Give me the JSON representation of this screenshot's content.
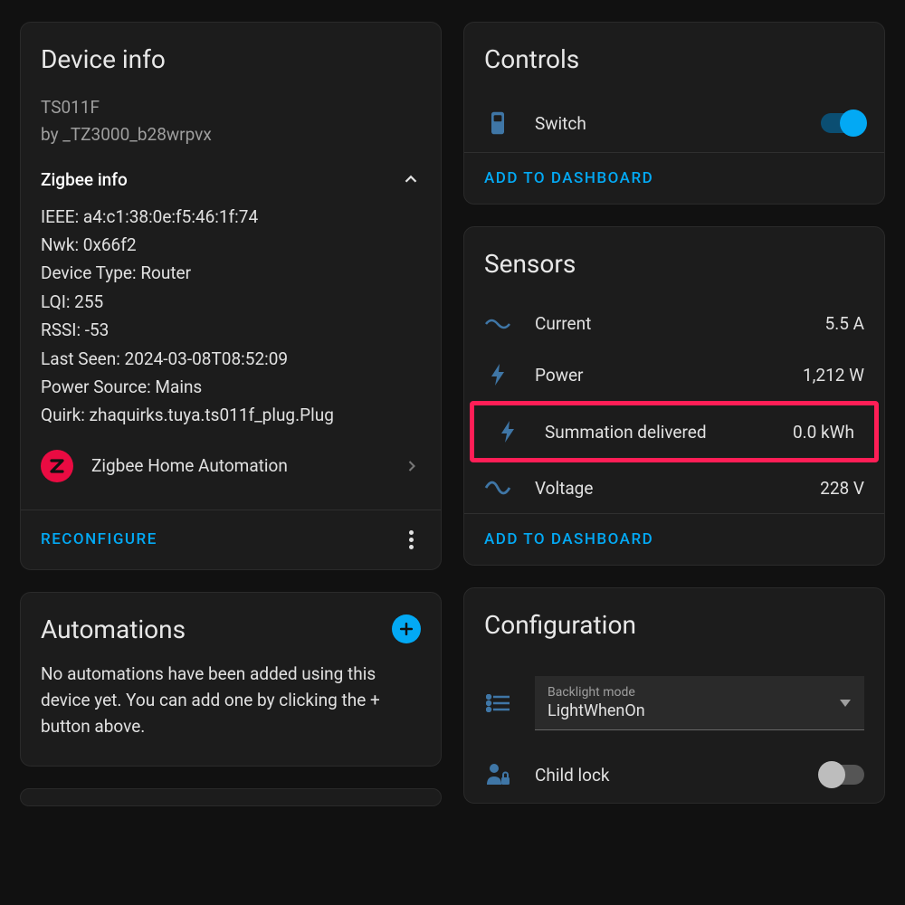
{
  "deviceInfo": {
    "title": "Device info",
    "model": "TS011F",
    "byline": "by _TZ3000_b28wrpvx",
    "zigbeeInfoLabel": "Zigbee info",
    "ieee": "IEEE: a4:c1:38:0e:f5:46:1f:74",
    "nwk": "Nwk: 0x66f2",
    "deviceType": "Device Type: Router",
    "lqi": "LQI: 255",
    "rssi": "RSSI: -53",
    "lastSeen": "Last Seen: 2024-03-08T08:52:09",
    "powerSource": "Power Source: Mains",
    "quirk": "Quirk: zhaquirks.tuya.ts011f_plug.Plug",
    "integration": "Zigbee Home Automation",
    "reconfigure": "RECONFIGURE"
  },
  "automations": {
    "title": "Automations",
    "body": "No automations have been added using this device yet. You can add one by clicking the + button above."
  },
  "controls": {
    "title": "Controls",
    "switchLabel": "Switch",
    "addToDashboard": "ADD TO DASHBOARD"
  },
  "sensors": {
    "title": "Sensors",
    "current": {
      "label": "Current",
      "value": "5.5 A"
    },
    "power": {
      "label": "Power",
      "value": "1,212 W"
    },
    "summation": {
      "label": "Summation delivered",
      "value": "0.0 kWh"
    },
    "voltage": {
      "label": "Voltage",
      "value": "228 V"
    },
    "addToDashboard": "ADD TO DASHBOARD"
  },
  "configuration": {
    "title": "Configuration",
    "backlightLabel": "Backlight mode",
    "backlightValue": "LightWhenOn",
    "childLockLabel": "Child lock"
  }
}
